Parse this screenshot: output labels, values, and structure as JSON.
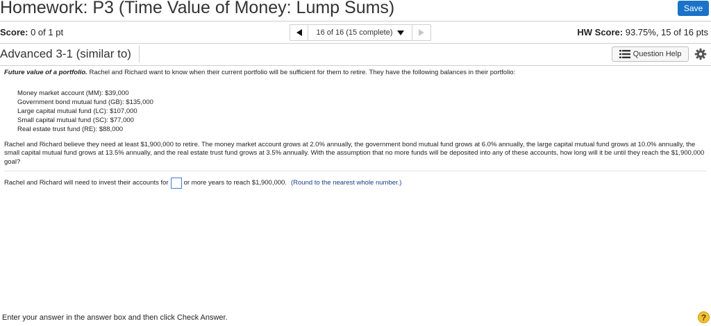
{
  "header": {
    "title": "Homework: P3 (Time Value of Money: Lump Sums)",
    "save_label": "Save"
  },
  "score": {
    "label": "Score:",
    "value": "0 of 1 pt"
  },
  "nav": {
    "position": "16 of 16 (15 complete)"
  },
  "hw_score": {
    "label": "HW Score:",
    "value": "93.75%, 15 of 16 pts"
  },
  "question": {
    "title": "Advanced 3-1 (similar to)",
    "help_label": "Question Help",
    "intro_bold": "Future value of a portfolio.",
    "intro_text": " Rachel and Richard want to know when their current portfolio will be sufficient for them to retire.  They have the following balances in their portfolio:",
    "funds": [
      "Money market account (MM):  $39,000",
      "Government bond mutual fund (GB):  $135,000",
      "Large capital mutual fund (LC):  $107,000",
      "Small capital mutual fund (SC):  $77,000",
      "Real estate trust fund (RE):  $88,000"
    ],
    "paragraph": "Rachel and Richard believe they need at least $1,900,000 to retire.  The money market account grows at 2.0% annually, the government bond mutual fund grows at 6.0% annually, the large capital mutual fund grows at 10.0% annually, the small  capital mutual fund grows at 13.5% annually, and the real estate trust fund grows at 3.5% annually.  With the assumption that no more funds will be deposited into any of these accounts, how long will it be until they reach the $1,900,000 goal?",
    "answer_prefix": "Rachel and Richard will need to invest their accounts for",
    "answer_suffix": "or more years to reach $1,900,000.",
    "answer_hint": "(Round to the nearest whole number.)",
    "answer_value": ""
  },
  "footer": {
    "instruction": "Enter your answer in the answer box and then click Check Answer.",
    "help_symbol": "?"
  },
  "colors": {
    "accent": "#1a73c8",
    "hint": "#1b3d86",
    "help_circle": "#f1c232"
  }
}
